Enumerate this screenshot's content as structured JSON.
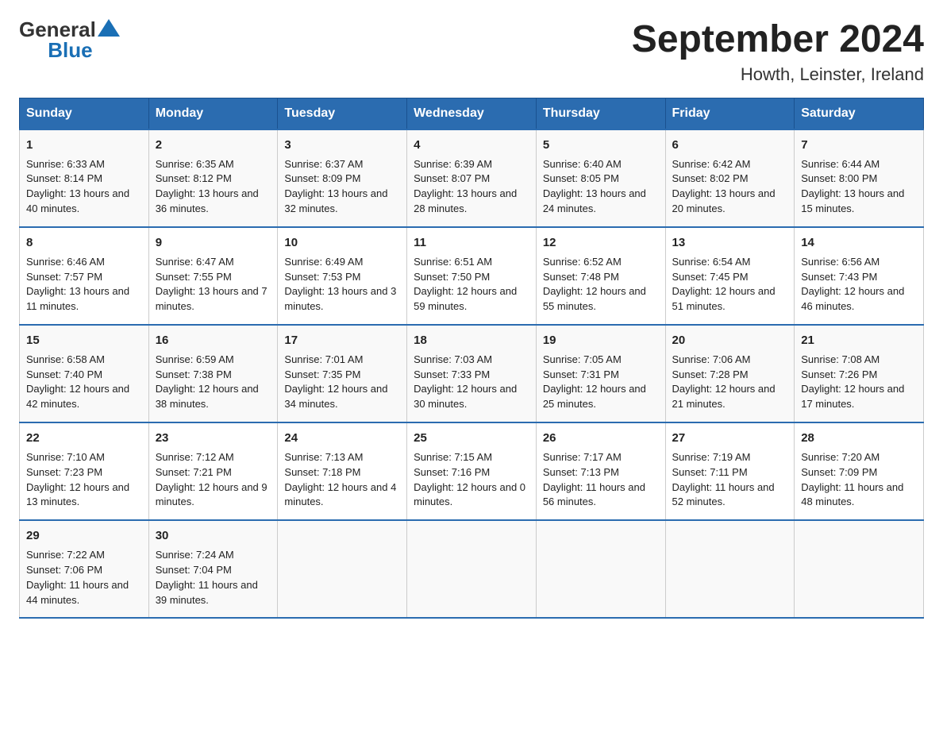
{
  "header": {
    "title": "September 2024",
    "subtitle": "Howth, Leinster, Ireland"
  },
  "logo": {
    "text_general": "General",
    "text_blue": "Blue"
  },
  "days_of_week": [
    "Sunday",
    "Monday",
    "Tuesday",
    "Wednesday",
    "Thursday",
    "Friday",
    "Saturday"
  ],
  "weeks": [
    [
      {
        "day": "1",
        "sunrise": "Sunrise: 6:33 AM",
        "sunset": "Sunset: 8:14 PM",
        "daylight": "Daylight: 13 hours and 40 minutes."
      },
      {
        "day": "2",
        "sunrise": "Sunrise: 6:35 AM",
        "sunset": "Sunset: 8:12 PM",
        "daylight": "Daylight: 13 hours and 36 minutes."
      },
      {
        "day": "3",
        "sunrise": "Sunrise: 6:37 AM",
        "sunset": "Sunset: 8:09 PM",
        "daylight": "Daylight: 13 hours and 32 minutes."
      },
      {
        "day": "4",
        "sunrise": "Sunrise: 6:39 AM",
        "sunset": "Sunset: 8:07 PM",
        "daylight": "Daylight: 13 hours and 28 minutes."
      },
      {
        "day": "5",
        "sunrise": "Sunrise: 6:40 AM",
        "sunset": "Sunset: 8:05 PM",
        "daylight": "Daylight: 13 hours and 24 minutes."
      },
      {
        "day": "6",
        "sunrise": "Sunrise: 6:42 AM",
        "sunset": "Sunset: 8:02 PM",
        "daylight": "Daylight: 13 hours and 20 minutes."
      },
      {
        "day": "7",
        "sunrise": "Sunrise: 6:44 AM",
        "sunset": "Sunset: 8:00 PM",
        "daylight": "Daylight: 13 hours and 15 minutes."
      }
    ],
    [
      {
        "day": "8",
        "sunrise": "Sunrise: 6:46 AM",
        "sunset": "Sunset: 7:57 PM",
        "daylight": "Daylight: 13 hours and 11 minutes."
      },
      {
        "day": "9",
        "sunrise": "Sunrise: 6:47 AM",
        "sunset": "Sunset: 7:55 PM",
        "daylight": "Daylight: 13 hours and 7 minutes."
      },
      {
        "day": "10",
        "sunrise": "Sunrise: 6:49 AM",
        "sunset": "Sunset: 7:53 PM",
        "daylight": "Daylight: 13 hours and 3 minutes."
      },
      {
        "day": "11",
        "sunrise": "Sunrise: 6:51 AM",
        "sunset": "Sunset: 7:50 PM",
        "daylight": "Daylight: 12 hours and 59 minutes."
      },
      {
        "day": "12",
        "sunrise": "Sunrise: 6:52 AM",
        "sunset": "Sunset: 7:48 PM",
        "daylight": "Daylight: 12 hours and 55 minutes."
      },
      {
        "day": "13",
        "sunrise": "Sunrise: 6:54 AM",
        "sunset": "Sunset: 7:45 PM",
        "daylight": "Daylight: 12 hours and 51 minutes."
      },
      {
        "day": "14",
        "sunrise": "Sunrise: 6:56 AM",
        "sunset": "Sunset: 7:43 PM",
        "daylight": "Daylight: 12 hours and 46 minutes."
      }
    ],
    [
      {
        "day": "15",
        "sunrise": "Sunrise: 6:58 AM",
        "sunset": "Sunset: 7:40 PM",
        "daylight": "Daylight: 12 hours and 42 minutes."
      },
      {
        "day": "16",
        "sunrise": "Sunrise: 6:59 AM",
        "sunset": "Sunset: 7:38 PM",
        "daylight": "Daylight: 12 hours and 38 minutes."
      },
      {
        "day": "17",
        "sunrise": "Sunrise: 7:01 AM",
        "sunset": "Sunset: 7:35 PM",
        "daylight": "Daylight: 12 hours and 34 minutes."
      },
      {
        "day": "18",
        "sunrise": "Sunrise: 7:03 AM",
        "sunset": "Sunset: 7:33 PM",
        "daylight": "Daylight: 12 hours and 30 minutes."
      },
      {
        "day": "19",
        "sunrise": "Sunrise: 7:05 AM",
        "sunset": "Sunset: 7:31 PM",
        "daylight": "Daylight: 12 hours and 25 minutes."
      },
      {
        "day": "20",
        "sunrise": "Sunrise: 7:06 AM",
        "sunset": "Sunset: 7:28 PM",
        "daylight": "Daylight: 12 hours and 21 minutes."
      },
      {
        "day": "21",
        "sunrise": "Sunrise: 7:08 AM",
        "sunset": "Sunset: 7:26 PM",
        "daylight": "Daylight: 12 hours and 17 minutes."
      }
    ],
    [
      {
        "day": "22",
        "sunrise": "Sunrise: 7:10 AM",
        "sunset": "Sunset: 7:23 PM",
        "daylight": "Daylight: 12 hours and 13 minutes."
      },
      {
        "day": "23",
        "sunrise": "Sunrise: 7:12 AM",
        "sunset": "Sunset: 7:21 PM",
        "daylight": "Daylight: 12 hours and 9 minutes."
      },
      {
        "day": "24",
        "sunrise": "Sunrise: 7:13 AM",
        "sunset": "Sunset: 7:18 PM",
        "daylight": "Daylight: 12 hours and 4 minutes."
      },
      {
        "day": "25",
        "sunrise": "Sunrise: 7:15 AM",
        "sunset": "Sunset: 7:16 PM",
        "daylight": "Daylight: 12 hours and 0 minutes."
      },
      {
        "day": "26",
        "sunrise": "Sunrise: 7:17 AM",
        "sunset": "Sunset: 7:13 PM",
        "daylight": "Daylight: 11 hours and 56 minutes."
      },
      {
        "day": "27",
        "sunrise": "Sunrise: 7:19 AM",
        "sunset": "Sunset: 7:11 PM",
        "daylight": "Daylight: 11 hours and 52 minutes."
      },
      {
        "day": "28",
        "sunrise": "Sunrise: 7:20 AM",
        "sunset": "Sunset: 7:09 PM",
        "daylight": "Daylight: 11 hours and 48 minutes."
      }
    ],
    [
      {
        "day": "29",
        "sunrise": "Sunrise: 7:22 AM",
        "sunset": "Sunset: 7:06 PM",
        "daylight": "Daylight: 11 hours and 44 minutes."
      },
      {
        "day": "30",
        "sunrise": "Sunrise: 7:24 AM",
        "sunset": "Sunset: 7:04 PM",
        "daylight": "Daylight: 11 hours and 39 minutes."
      },
      null,
      null,
      null,
      null,
      null
    ]
  ]
}
